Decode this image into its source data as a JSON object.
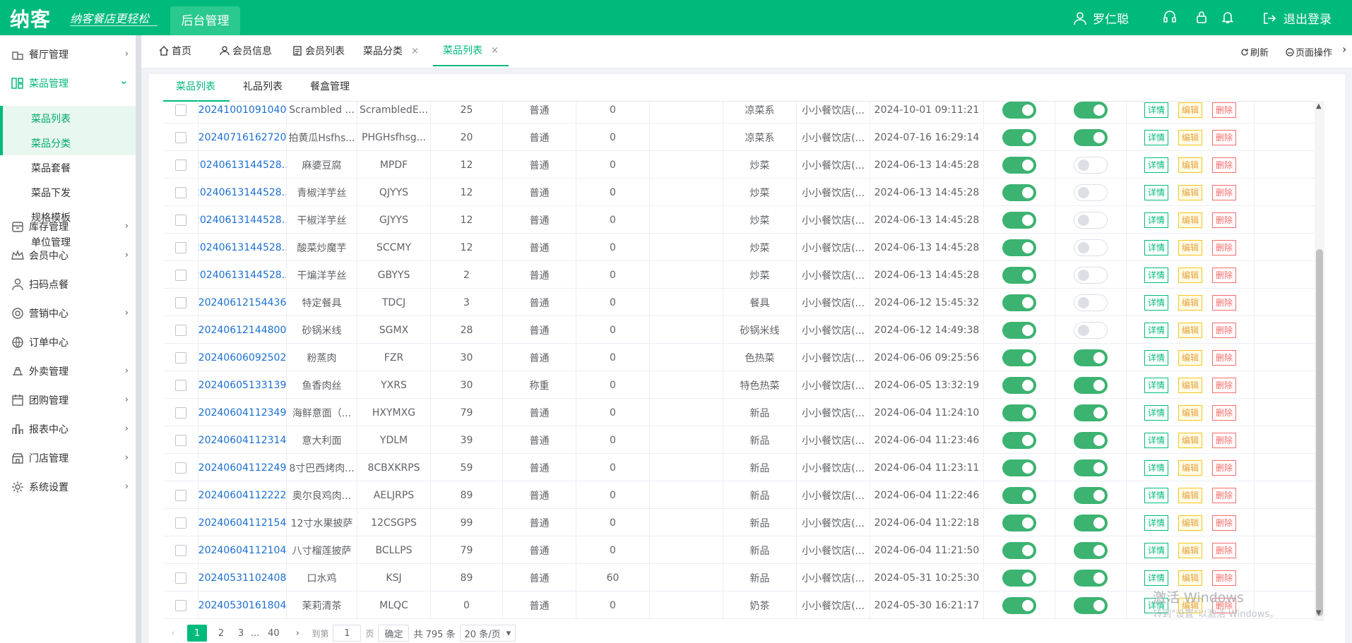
{
  "top": {
    "logo": "纳客",
    "slogan": "纳客餐店更轻松",
    "admin": "后台管理",
    "user": "罗仁聪",
    "logout": "退出登录"
  },
  "icons": [
    "user-icon",
    "headset-icon",
    "lock-icon",
    "bell-icon",
    "logout-icon"
  ],
  "sidebar": {
    "items": [
      {
        "label": "餐厅管理",
        "icon": "restaurant-icon",
        "arrow": "›"
      },
      {
        "label": "菜品管理",
        "icon": "dish-icon",
        "arrow": "⌄"
      },
      {
        "label": "库存管理",
        "icon": "inventory-icon",
        "arrow": "›"
      },
      {
        "label": "会员中心",
        "icon": "crown-icon",
        "arrow": "›"
      },
      {
        "label": "扫码点餐",
        "icon": "user-icon",
        "arrow": ""
      },
      {
        "label": "营销中心",
        "icon": "target-icon",
        "arrow": "›"
      },
      {
        "label": "订单中心",
        "icon": "globe-icon",
        "arrow": ""
      },
      {
        "label": "外卖管理",
        "icon": "delivery-icon",
        "arrow": "›"
      },
      {
        "label": "团购管理",
        "icon": "calendar-icon",
        "arrow": "›"
      },
      {
        "label": "报表中心",
        "icon": "chart-icon",
        "arrow": "›"
      },
      {
        "label": "门店管理",
        "icon": "store-icon",
        "arrow": "›"
      },
      {
        "label": "系统设置",
        "icon": "gear-icon",
        "arrow": "›"
      }
    ],
    "sub": [
      "菜品列表",
      "菜品分类",
      "菜品套餐",
      "菜品下发",
      "规格模板",
      "单位管理"
    ]
  },
  "tabs": [
    {
      "label": "首页",
      "icon": "home-icon"
    },
    {
      "label": "会员信息",
      "icon": "user-icon"
    },
    {
      "label": "会员列表",
      "icon": "list-icon"
    },
    {
      "label": "菜品分类",
      "close": "×"
    },
    {
      "label": "菜品列表",
      "close": "×"
    }
  ],
  "tab_tools": {
    "refresh": "刷新",
    "page_ops": "页面操作",
    "more": "›"
  },
  "subtabs": [
    "菜品列表",
    "礼品列表",
    "餐盒管理"
  ],
  "rows": [
    {
      "code": "20241001091040",
      "name": "Scrambled ...",
      "py": "ScrambledE...",
      "price": "25",
      "type": "普通",
      "n": "0",
      "cat": "凉菜系",
      "store": "小小餐饮店(...",
      "time": "2024-10-01 09:11:21",
      "s1": true,
      "s2": true
    },
    {
      "code": "20240716162720",
      "name": "拍黄瓜Hsfhs...",
      "py": "PHGHsfhsg...",
      "price": "20",
      "type": "普通",
      "n": "0",
      "cat": "凉菜系",
      "store": "小小餐饮店(...",
      "time": "2024-07-16 16:29:14",
      "s1": true,
      "s2": true
    },
    {
      "code": "20240613144528...",
      "name": "麻婆豆腐",
      "py": "MPDF",
      "price": "12",
      "type": "普通",
      "n": "0",
      "cat": "炒菜",
      "store": "小小餐饮店(...",
      "time": "2024-06-13 14:45:28",
      "s1": true,
      "s2": false
    },
    {
      "code": "20240613144528...",
      "name": "青椒洋芋丝",
      "py": "QJYYS",
      "price": "12",
      "type": "普通",
      "n": "0",
      "cat": "炒菜",
      "store": "小小餐饮店(...",
      "time": "2024-06-13 14:45:28",
      "s1": true,
      "s2": false
    },
    {
      "code": "20240613144528...",
      "name": "干椒洋芋丝",
      "py": "GJYYS",
      "price": "12",
      "type": "普通",
      "n": "0",
      "cat": "炒菜",
      "store": "小小餐饮店(...",
      "time": "2024-06-13 14:45:28",
      "s1": true,
      "s2": false
    },
    {
      "code": "20240613144528...",
      "name": "酸菜炒魔芋",
      "py": "SCCMY",
      "price": "12",
      "type": "普通",
      "n": "0",
      "cat": "炒菜",
      "store": "小小餐饮店(...",
      "time": "2024-06-13 14:45:28",
      "s1": true,
      "s2": false
    },
    {
      "code": "20240613144528...",
      "name": "干煸洋芋丝",
      "py": "GBYYS",
      "price": "2",
      "type": "普通",
      "n": "0",
      "cat": "炒菜",
      "store": "小小餐饮店(...",
      "time": "2024-06-13 14:45:28",
      "s1": true,
      "s2": false
    },
    {
      "code": "20240612154436",
      "name": "特定餐具",
      "py": "TDCJ",
      "price": "3",
      "type": "普通",
      "n": "0",
      "cat": "餐具",
      "store": "小小餐饮店(...",
      "time": "2024-06-12 15:45:32",
      "s1": true,
      "s2": false
    },
    {
      "code": "20240612144800",
      "name": "砂锅米线",
      "py": "SGMX",
      "price": "28",
      "type": "普通",
      "n": "0",
      "cat": "砂锅米线",
      "store": "小小餐饮店(...",
      "time": "2024-06-12 14:49:38",
      "s1": true,
      "s2": false
    },
    {
      "code": "20240606092502",
      "name": "粉蒸肉",
      "py": "FZR",
      "price": "30",
      "type": "普通",
      "n": "0",
      "cat": "色热菜",
      "store": "小小餐饮店(...",
      "time": "2024-06-06 09:25:56",
      "s1": true,
      "s2": true
    },
    {
      "code": "20240605133139",
      "name": "鱼香肉丝",
      "py": "YXRS",
      "price": "30",
      "type": "称重",
      "n": "0",
      "cat": "特色热菜",
      "store": "小小餐饮店(...",
      "time": "2024-06-05 13:32:19",
      "s1": true,
      "s2": true
    },
    {
      "code": "20240604112349",
      "name": "海鲜意面（...",
      "py": "HXYMXG",
      "price": "79",
      "type": "普通",
      "n": "0",
      "cat": "新品",
      "store": "小小餐饮店(...",
      "time": "2024-06-04 11:24:10",
      "s1": true,
      "s2": true
    },
    {
      "code": "20240604112314",
      "name": "意大利面",
      "py": "YDLM",
      "price": "39",
      "type": "普通",
      "n": "0",
      "cat": "新品",
      "store": "小小餐饮店(...",
      "time": "2024-06-04 11:23:46",
      "s1": true,
      "s2": true
    },
    {
      "code": "20240604112249",
      "name": "8寸巴西烤肉...",
      "py": "8CBXKRPS",
      "price": "59",
      "type": "普通",
      "n": "0",
      "cat": "新品",
      "store": "小小餐饮店(...",
      "time": "2024-06-04 11:23:11",
      "s1": true,
      "s2": true
    },
    {
      "code": "20240604112222",
      "name": "奥尔良鸡肉...",
      "py": "AELJRPS",
      "price": "89",
      "type": "普通",
      "n": "0",
      "cat": "新品",
      "store": "小小餐饮店(...",
      "time": "2024-06-04 11:22:46",
      "s1": true,
      "s2": true
    },
    {
      "code": "20240604112154",
      "name": "12寸水果披萨",
      "py": "12CSGPS",
      "price": "99",
      "type": "普通",
      "n": "0",
      "cat": "新品",
      "store": "小小餐饮店(...",
      "time": "2024-06-04 11:22:18",
      "s1": true,
      "s2": true
    },
    {
      "code": "20240604112104",
      "name": "八寸榴莲披萨",
      "py": "BCLLPS",
      "price": "79",
      "type": "普通",
      "n": "0",
      "cat": "新品",
      "store": "小小餐饮店(...",
      "time": "2024-06-04 11:21:50",
      "s1": true,
      "s2": true
    },
    {
      "code": "20240531102408",
      "name": "口水鸡",
      "py": "KSJ",
      "price": "89",
      "type": "普通",
      "n": "60",
      "cat": "新品",
      "store": "小小餐饮店(...",
      "time": "2024-05-31 10:25:30",
      "s1": true,
      "s2": true
    },
    {
      "code": "20240530161804",
      "name": "茉莉清茶",
      "py": "MLQC",
      "price": "0",
      "type": "普通",
      "n": "0",
      "cat": "奶茶",
      "store": "小小餐饮店(...",
      "time": "2024-05-30 16:21:17",
      "s1": true,
      "s2": true
    }
  ],
  "actions": {
    "detail": "详情",
    "edit": "编辑",
    "delete": "删除"
  },
  "pager": {
    "prev": "‹",
    "pages": [
      "1",
      "2",
      "3"
    ],
    "ellipsis": "...",
    "last": "40",
    "next": "›",
    "goto": "到第",
    "page_value": "1",
    "page_unit": "页",
    "confirm": "确定",
    "total": "共 795 条",
    "size": "20 条/页",
    "size_arrow": "▾"
  },
  "watermark": {
    "line1": "激活 Windows",
    "line2": "转到\"设置\"以激活 Windows。"
  }
}
